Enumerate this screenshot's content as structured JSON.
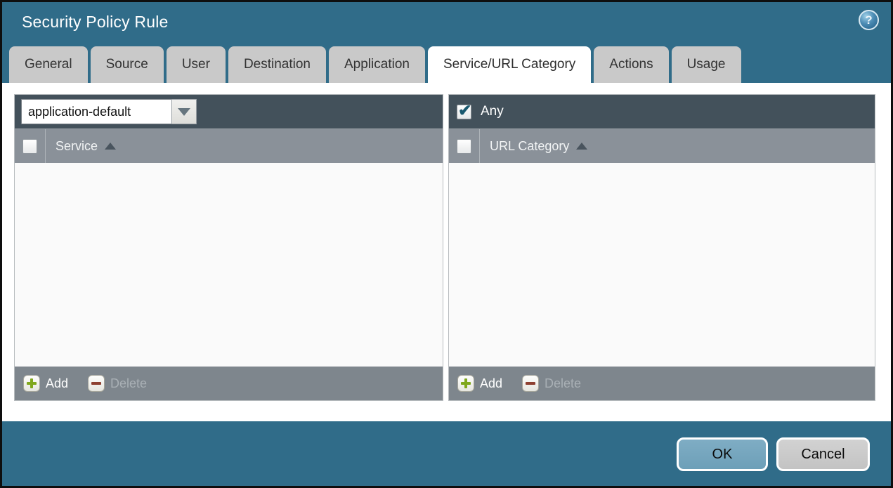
{
  "window": {
    "title": "Security Policy Rule",
    "help_glyph": "?"
  },
  "tabs": [
    {
      "label": "General"
    },
    {
      "label": "Source"
    },
    {
      "label": "User"
    },
    {
      "label": "Destination"
    },
    {
      "label": "Application"
    },
    {
      "label": "Service/URL Category"
    },
    {
      "label": "Actions"
    },
    {
      "label": "Usage"
    }
  ],
  "active_tab": "Service/URL Category",
  "service_panel": {
    "dropdown_value": "application-default",
    "column_header": "Service",
    "sort_order": "ascending",
    "header_checkbox_checked": false,
    "rows": [],
    "toolbar": {
      "add_label": "Add",
      "delete_label": "Delete",
      "delete_enabled": false
    }
  },
  "url_category_panel": {
    "any_label": "Any",
    "any_checked": true,
    "column_header": "URL Category",
    "sort_order": "ascending",
    "header_checkbox_checked": false,
    "rows": [],
    "toolbar": {
      "add_label": "Add",
      "delete_label": "Delete",
      "delete_enabled": false
    }
  },
  "footer": {
    "ok_label": "OK",
    "cancel_label": "Cancel"
  },
  "colors": {
    "dialog_background": "#306c89",
    "panel_topbar": "#43515b",
    "column_header_bar": "#8a9199",
    "toolbar_bar": "#7e868d",
    "tab_inactive": "#c9c9c9",
    "tab_active": "#ffffff",
    "ok_button": "#6d9fb8",
    "cancel_button": "#c9c9c9",
    "add_plus_green": "#7fa71c",
    "delete_minus_red": "#8e4030",
    "checkmark_blue": "#19596f"
  }
}
